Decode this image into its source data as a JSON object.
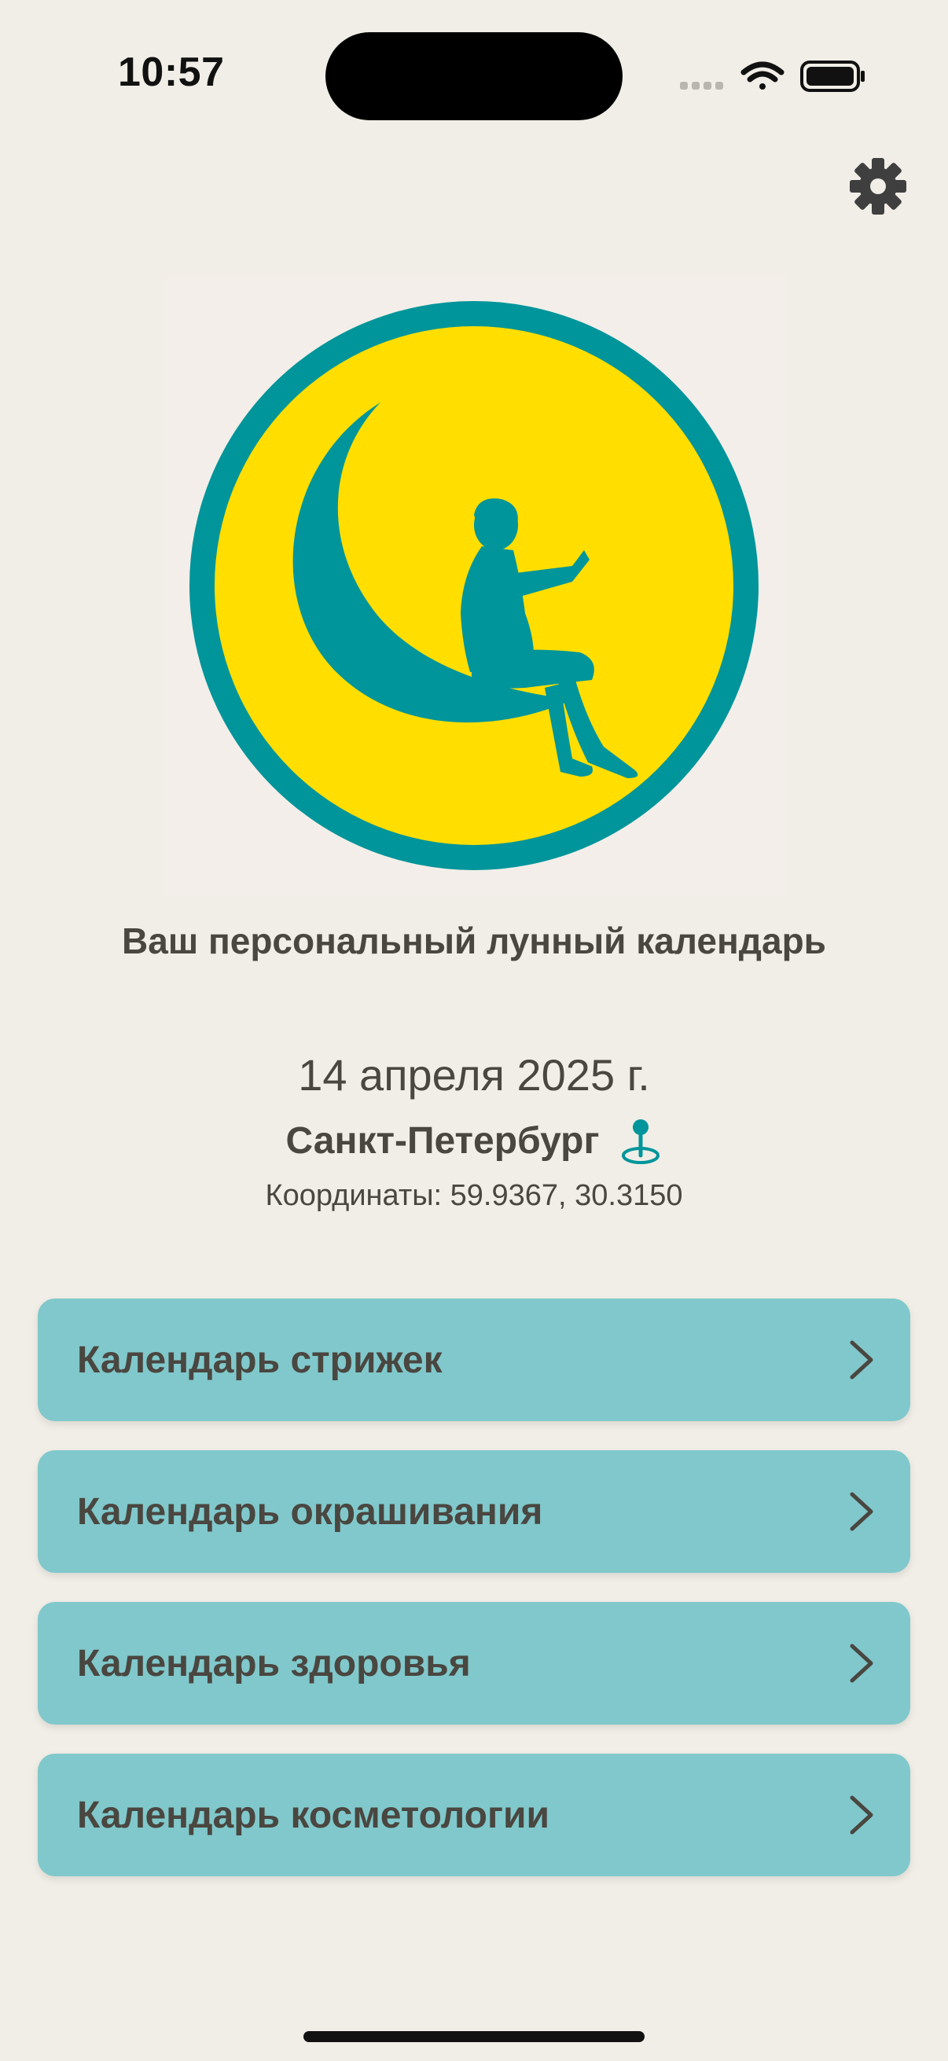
{
  "status_bar": {
    "time": "10:57"
  },
  "header": {
    "settings_icon": "gear-icon"
  },
  "logo": {
    "description_icon": "moon-reader-logo",
    "ring_color": "#00959a",
    "fill_color": "#ffde00"
  },
  "tagline": "Ваш персональный лунный календарь",
  "info": {
    "date": "14 апреля 2025 г.",
    "city": "Санкт-Петербург",
    "location_icon": "map-pin-icon",
    "coordinates": "Координаты: 59.9367, 30.3150"
  },
  "menu": {
    "items": [
      {
        "label": "Календарь стрижек",
        "icon": "chevron-right-icon"
      },
      {
        "label": "Календарь окрашивания",
        "icon": "chevron-right-icon"
      },
      {
        "label": "Календарь здоровья",
        "icon": "chevron-right-icon"
      },
      {
        "label": "Календарь косметологии",
        "icon": "chevron-right-icon"
      }
    ]
  },
  "colors": {
    "background": "#f1eee7",
    "card": "#80c8cb",
    "text": "#4a4640",
    "accent": "#00959a"
  }
}
